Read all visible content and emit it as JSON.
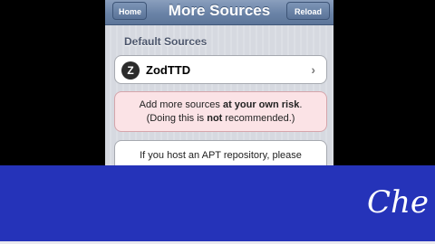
{
  "navbar": {
    "title": "More Sources",
    "home_label": "Home",
    "reload_label": "Reload"
  },
  "section": {
    "header": "Default Sources"
  },
  "source": {
    "icon": "Z",
    "label": "ZodTTD",
    "chevron": "›"
  },
  "warning": {
    "p1_a": "Add more sources ",
    "p1_b": "at your own risk",
    "p1_c": ".",
    "p2_a": "(Doing this is ",
    "p2_b": "not",
    "p2_c": " recommended.)"
  },
  "info": {
    "line1": "If you host an APT repository, please"
  },
  "banner": {
    "text": "Che"
  },
  "colors": {
    "navbar": "#6a83a7",
    "warning_bg": "#fbe3e6",
    "banner": "#2533b9"
  }
}
